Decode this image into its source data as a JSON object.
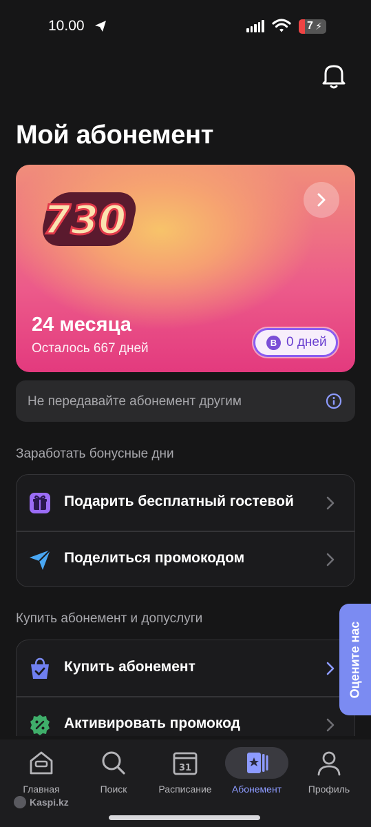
{
  "status_bar": {
    "time": "10.00",
    "battery": "7"
  },
  "header": {
    "title": "Мой абонемент"
  },
  "subscription_card": {
    "period": "24 месяца",
    "remaining": "Осталось 667 дней",
    "bonus_badge": "B",
    "bonus_days": "0 дней",
    "logo_text": "730"
  },
  "notice": {
    "text": "Не передавайте абонемент другим"
  },
  "bonus_section": {
    "label": "Заработать бонусные дни",
    "items": [
      {
        "label": "Подарить бесплатный гостевой",
        "icon": "gift-icon"
      },
      {
        "label": "Поделиться промокодом",
        "icon": "send-icon"
      }
    ]
  },
  "buy_section": {
    "label": "Купить абонемент и допуслуги",
    "items": [
      {
        "label": "Купить абонемент",
        "icon": "shopping-bag-icon"
      },
      {
        "label": "Активировать промокод",
        "icon": "promo-badge-icon"
      }
    ]
  },
  "rate_tab": {
    "label": "Оцените нас"
  },
  "bottom_nav": {
    "items": [
      {
        "label": "Главная",
        "icon": "home-icon"
      },
      {
        "label": "Поиск",
        "icon": "search-icon"
      },
      {
        "label": "Расписание",
        "icon": "calendar-icon",
        "badge": "31"
      },
      {
        "label": "Абонемент",
        "icon": "membership-card-icon",
        "active": true
      },
      {
        "label": "Профиль",
        "icon": "profile-icon"
      }
    ]
  },
  "watermark": "Kaspi.kz",
  "colors": {
    "accent": "#8d9bff",
    "rate_tab": "#7b8bf2",
    "background": "#161617"
  }
}
